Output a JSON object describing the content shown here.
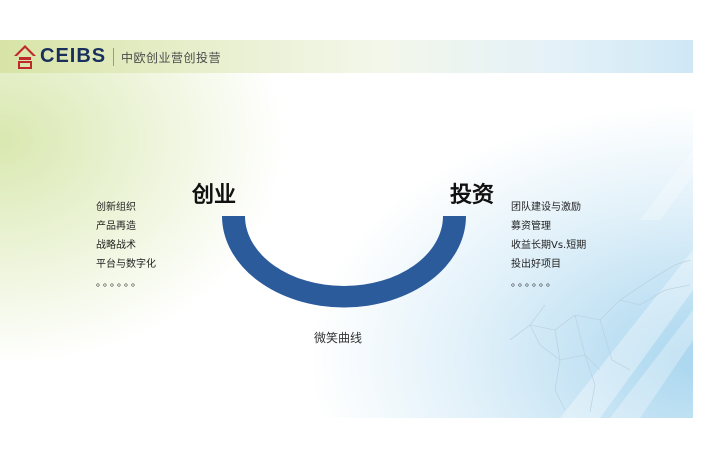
{
  "header": {
    "logo_text": "CEIBS",
    "subtitle": "中欧创业营创投营"
  },
  "left": {
    "heading": "创业",
    "items": [
      "创新组织",
      "产品再造",
      "战略战术",
      "平台与数字化",
      "。。。。。。"
    ]
  },
  "right": {
    "heading": "投资",
    "items": [
      "团队建设与激励",
      "募资管理",
      "收益长期Vs.短期",
      "投出好项目",
      "。。。。。。"
    ]
  },
  "curve_label": "微笑曲线",
  "colors": {
    "curve": "#2c5b9c",
    "logo_red": "#c0282c",
    "logo_blue": "#1a2f5c"
  }
}
